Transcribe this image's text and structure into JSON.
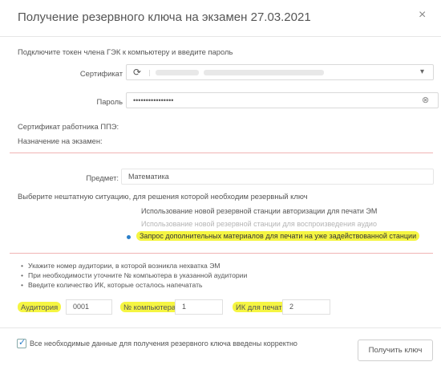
{
  "dialog": {
    "title": "Получение резервного ключа на экзамен 27.03.2021",
    "close_glyph": "×",
    "intro": "Подключите токен члена ГЭК к компьютеру и введите пароль"
  },
  "certificate": {
    "label": "Сертификат",
    "refresh_icon": "⟳",
    "dropdown_icon": "▾"
  },
  "password": {
    "label": "Пароль",
    "value": "••••••••••••••••",
    "clear_icon": "⊗"
  },
  "info": {
    "ppe_cert_label": "Сертификат работника ППЭ:",
    "assignment_label": "Назначение на экзамен:"
  },
  "subject": {
    "label": "Предмет:",
    "value": "Математика"
  },
  "situation": {
    "prompt": "Выберите нештатную ситуацию, для решения которой необходим резервный ключ",
    "options": [
      {
        "label": "Использование новой резервной станции авторизации для печати ЭМ",
        "state": "normal"
      },
      {
        "label": "Использование новой резервной станции для воспроизведения аудио",
        "state": "disabled"
      },
      {
        "label": "Запрос дополнительных материалов для печати на уже задействованной станции",
        "state": "selected"
      }
    ]
  },
  "instructions": [
    "Укажите номер аудитории, в которой возникла нехватка ЭМ",
    "При необходимости уточните № компьютера в указанной аудитории",
    "Введите количество ИК, которые осталось напечатать"
  ],
  "fields": {
    "auditorium": {
      "label": "Аудитория",
      "value": "0001"
    },
    "computer": {
      "label": "№ компьютера",
      "value": "1"
    },
    "ik_print": {
      "label": "ИК для печати",
      "value": "2"
    }
  },
  "footer": {
    "confirm_text": "Все необходимые данные для получения резервного ключа введены корректно",
    "confirm_checked": true,
    "check_glyph": "✓",
    "get_key_button": "Получить ключ"
  },
  "colors": {
    "highlight": "#f5f542",
    "accent": "#2a7fc9",
    "separator": "#f0b4b4"
  }
}
